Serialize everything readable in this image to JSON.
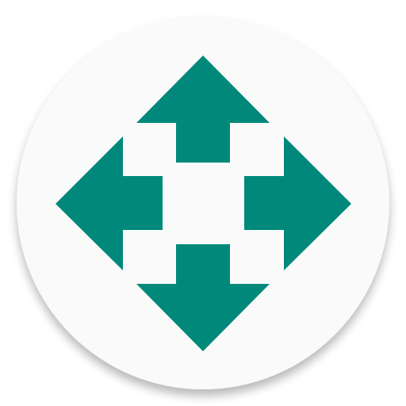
{
  "icon": {
    "name": "move-arrows-icon",
    "background_color": "#fafafa",
    "arrow_color": "#00897b"
  }
}
